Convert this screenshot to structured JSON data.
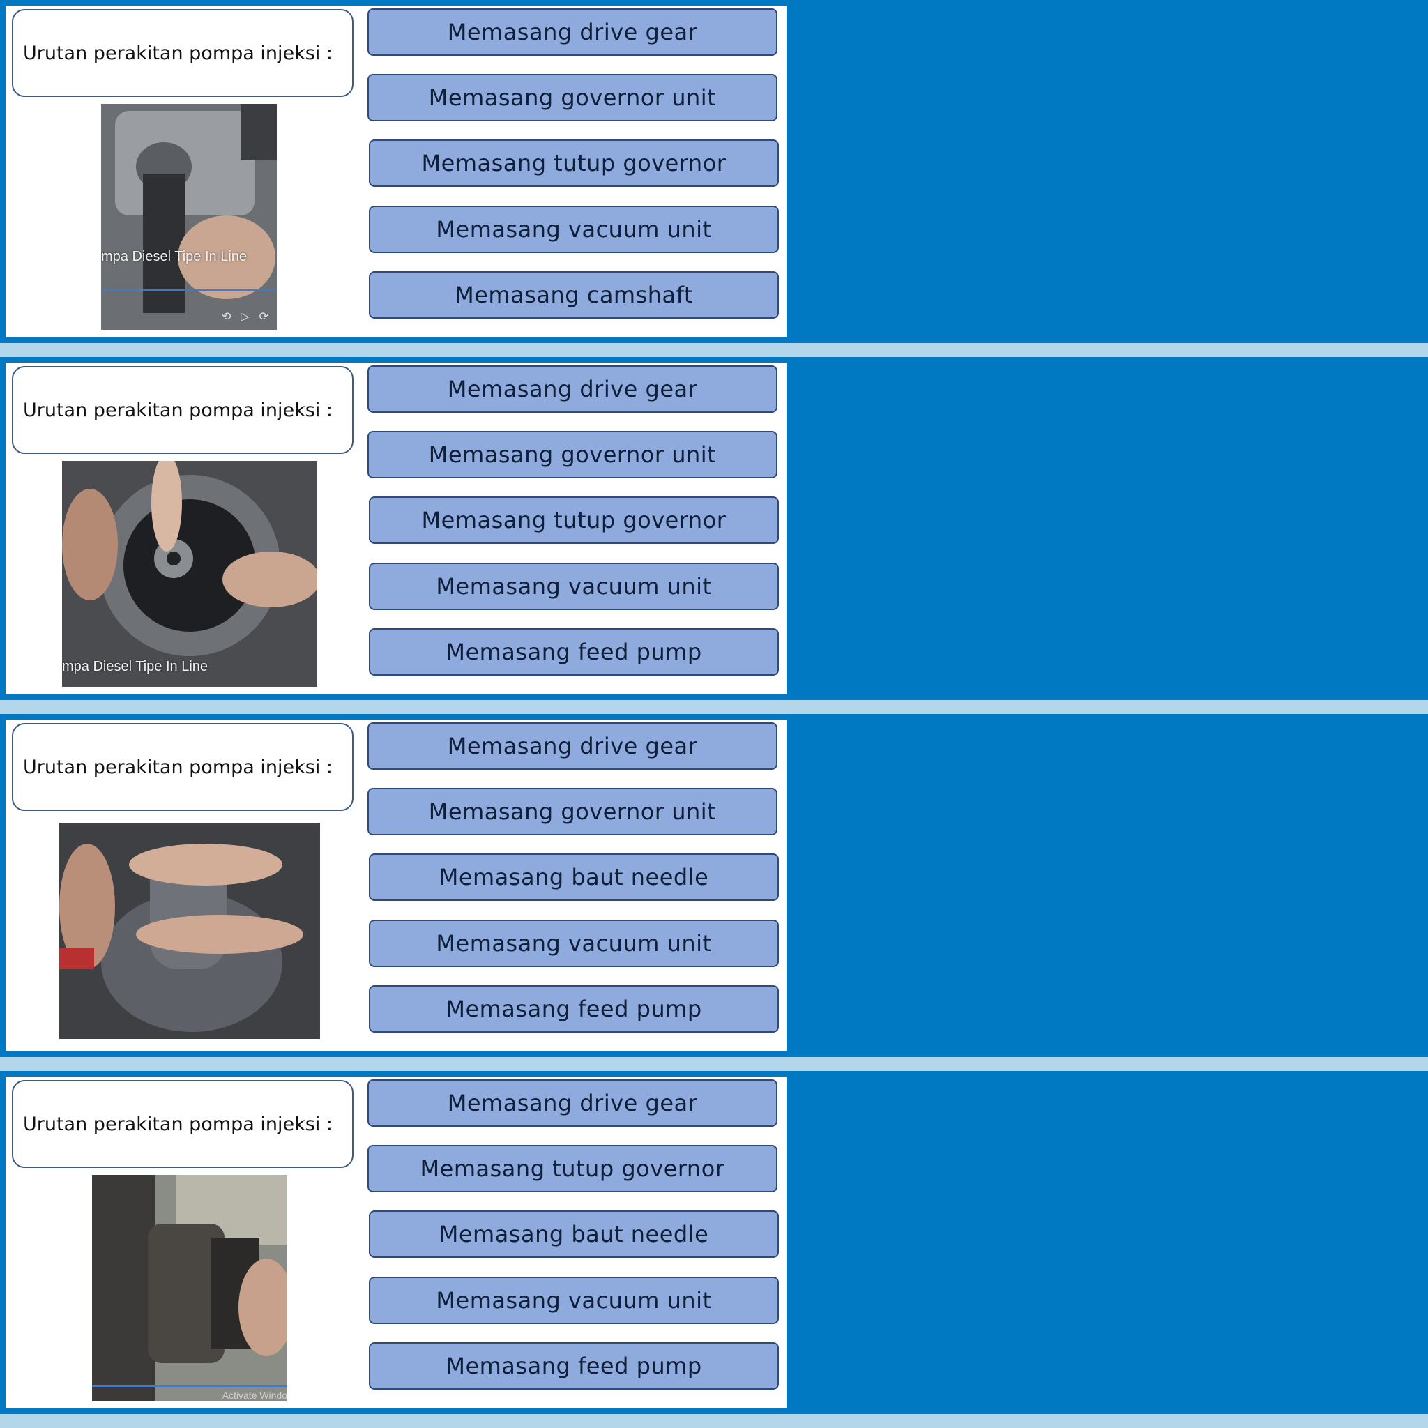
{
  "panels": [
    {
      "question": "Urutan perakitan pompa injeksi :",
      "photo_caption": "mpa Diesel Tipe In Line",
      "options": [
        "Memasang drive gear",
        "Memasang governor unit",
        "Memasang tutup governor",
        "Memasang vacuum unit",
        "Memasang camshaft"
      ]
    },
    {
      "question": "Urutan perakitan pompa injeksi :",
      "photo_caption": "mpa Diesel Tipe In Line",
      "options": [
        "Memasang drive gear",
        "Memasang governor unit",
        "Memasang tutup governor",
        "Memasang vacuum unit",
        "Memasang feed pump"
      ]
    },
    {
      "question": "Urutan perakitan pompa injeksi :",
      "options": [
        "Memasang drive gear",
        "Memasang governor unit",
        "Memasang baut needle",
        "Memasang vacuum unit",
        "Memasang feed pump"
      ]
    },
    {
      "question": "Urutan perakitan pompa injeksi :",
      "photo_watermark": "Activate Windo",
      "options": [
        "Memasang drive gear",
        "Memasang tutup governor",
        "Memasang baut needle",
        "Memasang vacuum unit",
        "Memasang feed pump"
      ]
    }
  ]
}
